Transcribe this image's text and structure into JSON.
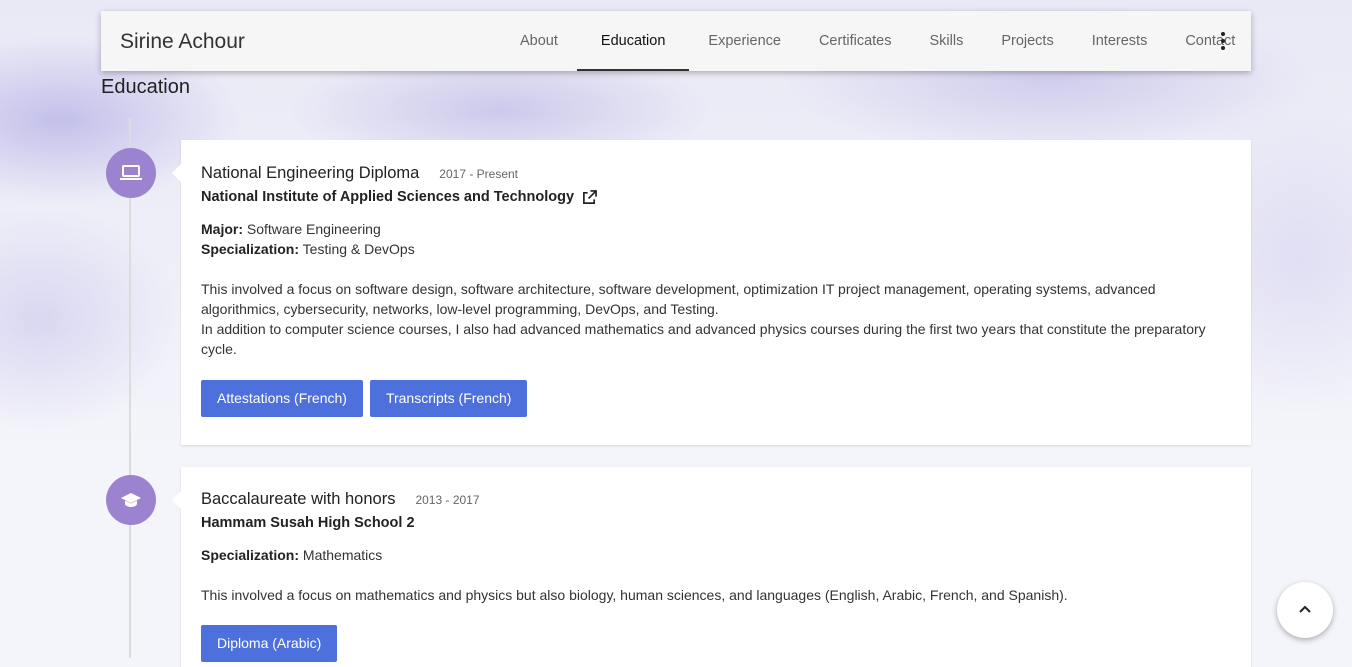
{
  "navbar": {
    "brand": "Sirine Achour",
    "links": [
      "About",
      "Education",
      "Experience",
      "Certificates",
      "Skills",
      "Projects",
      "Interests",
      "Contact"
    ],
    "active": "Education",
    "more_icon": "kebab-menu-icon"
  },
  "section": {
    "title": "Education"
  },
  "education": [
    {
      "icon": "laptop-icon",
      "degree": "National Engineering Diploma",
      "dates": "2017 - Present",
      "school": "National Institute of Applied Sciences and Technology",
      "school_link_icon": "external-link-icon",
      "major_label": "Major:",
      "major": "Software Engineering",
      "spec_label": "Specialization:",
      "specialization": "Testing & DevOps",
      "description_1": "This involved a focus on software design, software architecture, software development, optimization IT project management, operating systems, advanced algorithmics, cybersecurity, networks, low-level programming, DevOps, and Testing.",
      "description_2": "In addition to computer science courses, I also had advanced mathematics and advanced physics courses during the first two years that constitute the preparatory cycle.",
      "buttons": [
        "Attestations (French)",
        "Transcripts (French)"
      ]
    },
    {
      "icon": "graduation-cap-icon",
      "degree": "Baccalaureate with honors",
      "dates": "2013 - 2017",
      "school": "Hammam Susah High School 2",
      "spec_label": "Specialization:",
      "specialization": "Mathematics",
      "description_1": "This involved a focus on mathematics and physics but also biology, human sciences, and languages (English, Arabic, French, and Spanish).",
      "buttons": [
        "Diploma (Arabic)"
      ]
    }
  ],
  "back_to_top_icon": "chevron-up-icon",
  "colors": {
    "accent": "#4d70dd",
    "timeline_icon": "#9b83cf"
  }
}
